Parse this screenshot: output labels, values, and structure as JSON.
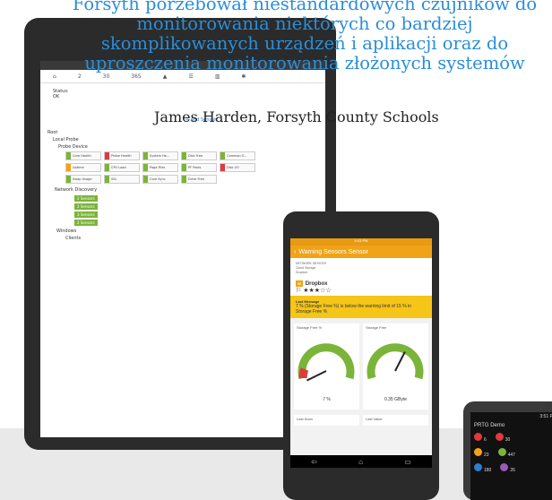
{
  "quote": {
    "lines": [
      "Forsyth porzebował niestandardowych czujników do",
      "monitorowania niektórych co bardziej",
      "skomplikowanych urządzeń i aplikacji oraz do",
      "uproszczenia monitorowania złożonych systemów"
    ],
    "author": "James Harden, Forsyth County Schools"
  },
  "tablet": {
    "tabs": [
      "2",
      "30",
      "365"
    ],
    "status_label": "Status:",
    "status_value": "OK",
    "add_sensor": "Add Sensor",
    "tree": {
      "root": "Root",
      "local_probe": "Local Probe",
      "probe_device": "Probe Device",
      "network_discovery": "Network Discovery",
      "windows": "Windows",
      "clients": "Clients"
    },
    "sensors": [
      "Core Health",
      "Probe Health",
      "System He...",
      "Disk Free",
      "Common S...",
      "Uptime",
      "CPU Load",
      "Page Files",
      "PF Pools",
      "Disk I/O",
      "Swap Usage",
      "SSL",
      "Core Sync",
      "Drive Free"
    ],
    "badges": [
      "2 Sensors",
      "2 Sensors",
      "3 Sensors",
      "2 Sensors"
    ]
  },
  "phone": {
    "time": "5:03 PM",
    "header": "Warning Sensors Sensor",
    "crumbs": [
      "NETWORK DEVICES",
      "Cloud Storage",
      "Dropbox"
    ],
    "device": "Dropbox",
    "stars": "★★★☆☆",
    "last_message_label": "Last Message",
    "last_message": "7 % (Storage Free %) is below the warning limit of 15 % in Storage Free %",
    "gauge1": {
      "label": "Storage Free %",
      "value": "7 %",
      "fraction": 0.07
    },
    "gauge2": {
      "label": "Storage Free",
      "value": "0.35 GByte",
      "fraction": 0.6
    },
    "last_scan": "Last Scan",
    "last_value": "Last Value"
  },
  "watch": {
    "time": "3:51 PM",
    "title": "PRTG Demo",
    "counts": [
      {
        "value": "6",
        "color": "#e0393e"
      },
      {
        "value": "30",
        "color": "#e0393e"
      },
      {
        "value": "23",
        "color": "#f0a318"
      },
      {
        "value": "447",
        "color": "#7bb43a"
      },
      {
        "value": "180",
        "color": "#2a7fcf"
      },
      {
        "value": "26",
        "color": "#9b59b6"
      }
    ]
  },
  "colors": {
    "accent": "#2a8ed8",
    "warning": "#f0a318",
    "ok": "#7bb43a"
  }
}
